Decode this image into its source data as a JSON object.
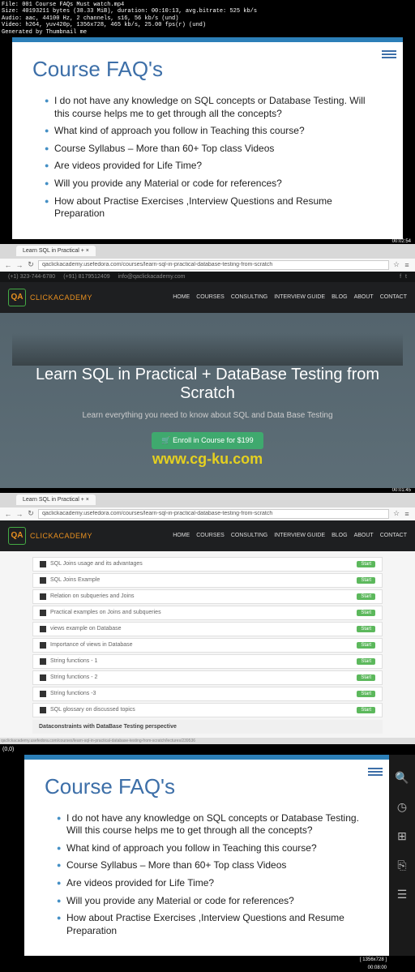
{
  "file_info": {
    "file": "File: 001 Course FAQs Must watch.mp4",
    "size": "Size: 40193211 bytes (38.33 MiB), duration: 00:10:13, avg.bitrate: 525 kb/s",
    "audio": "Audio: aac, 44100 Hz, 2 channels, s16, 56 kb/s (und)",
    "video": "Video: h264, yuv420p, 1356x728, 465 kb/s, 25.00 fps(r) (und)",
    "generated": "Generated by Thumbnail me"
  },
  "slide": {
    "title": "Course FAQ's",
    "bullets": [
      "I do not have any knowledge on SQL concepts  or Database Testing. Will this course helps me to get through all the concepts?",
      "What kind of approach you follow in Teaching this course?",
      " Course Syllabus – More than 60+ Top class Videos",
      "Are videos provided for Life Time?",
      "Will you provide any Material or code for references?",
      "How about Practise Exercises ,Interview Questions and Resume Preparation"
    ]
  },
  "timestamps": {
    "t1": "00:02:54",
    "t2": "00:01:45",
    "t3": "[ 1356x728 ]",
    "t4": "00:08:00"
  },
  "browser": {
    "tab_title": "Learn SQL in Practical +",
    "url": "qaclickacademy.usefedora.com/courses/learn-sql-in-practical-database-testing-from-scratch",
    "url2": "qaclickacademy.usefedora.com/courses/learn-sql-in-practical-database-testing-from-scratch",
    "bottom_url": "qaclickacademy.usefedora.com/courses/learn-sql-in-practical-database-testing-from-scratch/lectures/239536"
  },
  "contact": {
    "phone1": "(+1) 323-744-6780",
    "phone2": "(+91) 8179512409",
    "email": "info@qaclickacademy.com"
  },
  "logo_text": "CLICKACADEMY",
  "nav": [
    "HOME",
    "COURSES",
    "CONSULTING",
    "INTERVIEW GUIDE",
    "BLOG",
    "ABOUT",
    "CONTACT"
  ],
  "hero": {
    "title": "Learn SQL in Practical + DataBase Testing from Scratch",
    "sub": "Learn everything you need to know about SQL and Data Base Testing",
    "enroll": "Enroll in Course for $199",
    "watermark": "www.cg-ku.com"
  },
  "course_items": [
    "SQL Joins usage and its advantages",
    "SQL Joins Example",
    "Relation on subqueries and Joins",
    "Practical examples on Joins and subqueries",
    "views example on Database",
    "Importance of views in Database",
    "String functions - 1",
    "String functions - 2",
    "String functions -3",
    "SQL glossary on discussed topics"
  ],
  "section_header": "Dataconstraints with DataBase Testing perspective",
  "start_label": "Start",
  "coord": "(0,0)"
}
